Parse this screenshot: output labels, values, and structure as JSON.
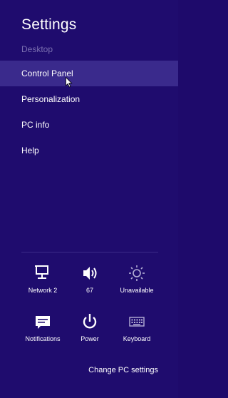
{
  "charm": {
    "title": "Settings",
    "context": "Desktop",
    "menu": [
      {
        "label": "Control Panel"
      },
      {
        "label": "Personalization"
      },
      {
        "label": "PC info"
      },
      {
        "label": "Help"
      }
    ],
    "tiles": [
      {
        "icon": "network-icon",
        "label": "Network  2"
      },
      {
        "icon": "volume-icon",
        "label": "67"
      },
      {
        "icon": "brightness-icon",
        "label": "Unavailable"
      },
      {
        "icon": "notifications-icon",
        "label": "Notifications"
      },
      {
        "icon": "power-icon",
        "label": "Power"
      },
      {
        "icon": "keyboard-icon",
        "label": "Keyboard"
      }
    ],
    "footer_link": "Change PC settings"
  },
  "colors": {
    "background": "#1f0c6e",
    "hover": "#3a2a8c",
    "context_text": "#7a6fb0"
  }
}
